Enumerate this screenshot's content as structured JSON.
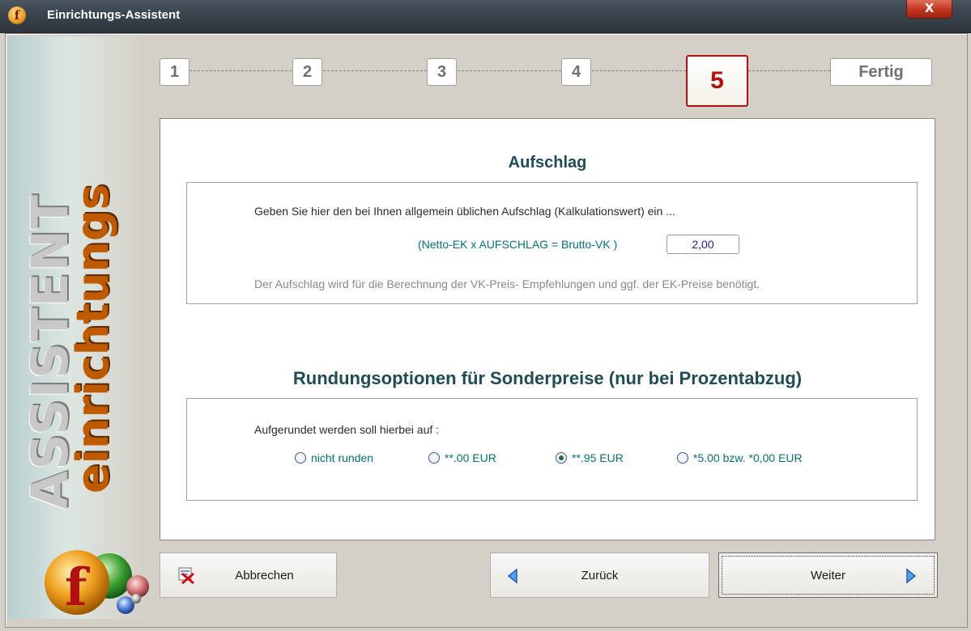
{
  "window": {
    "title": "Einrichtungs-Assistent",
    "close_glyph": "X",
    "app_icon_letter": "f"
  },
  "side_panel": {
    "word_top": "ASSISTENT",
    "word_bottom": "einrichtungs",
    "logo_letter": "f"
  },
  "steps": [
    {
      "label": "1",
      "active": false
    },
    {
      "label": "2",
      "active": false
    },
    {
      "label": "3",
      "active": false
    },
    {
      "label": "4",
      "active": false
    },
    {
      "label": "5",
      "active": true
    },
    {
      "label": "Fertig",
      "active": false
    }
  ],
  "aufschlag": {
    "heading": "Aufschlag",
    "description": "Geben Sie hier den bei Ihnen allgemein üblichen Aufschlag (Kalkulationswert) ein ...",
    "formula": "(Netto-EK x AUFSCHLAG = Brutto-VK )",
    "value": "2,00",
    "note": "Der Aufschlag wird für die Berechnung der VK-Preis- Empfehlungen und ggf. der EK-Preise benötigt."
  },
  "rundung": {
    "heading": "Rundungsoptionen für Sonderpreise (nur bei Prozentabzug)",
    "prompt": "Aufgerundet werden soll hierbei auf :",
    "options": [
      {
        "label": "nicht runden",
        "checked": false
      },
      {
        "label": "**.00 EUR",
        "checked": false
      },
      {
        "label": "**.95 EUR",
        "checked": true
      },
      {
        "label": "*5.00 bzw. *0,00 EUR",
        "checked": false
      }
    ]
  },
  "buttons": {
    "cancel": "Abbrechen",
    "back": "Zurück",
    "next": "Weiter"
  },
  "colors": {
    "accent_red": "#b80c0c",
    "teal": "#007575",
    "heading": "#1e4d55",
    "arrow_blue": "#1e6fd0"
  }
}
